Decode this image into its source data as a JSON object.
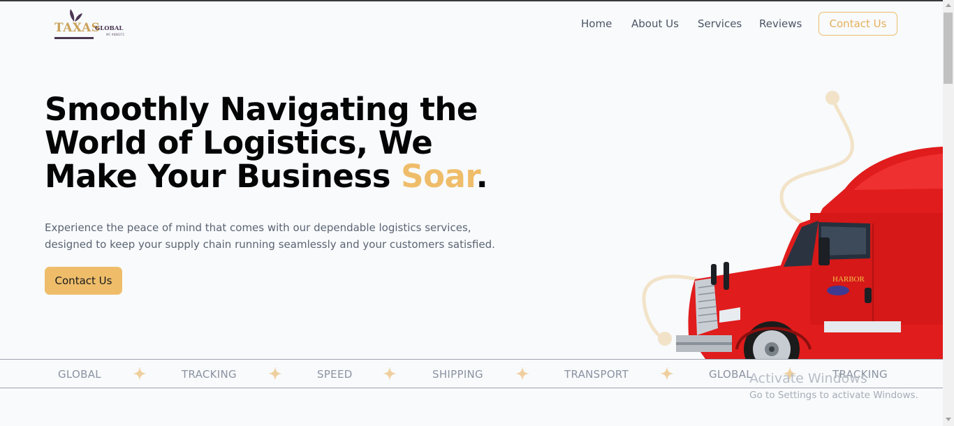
{
  "brand": {
    "logo_main": "TAXAS",
    "logo_side": "GLOBAL",
    "logo_sub": "MC #880271"
  },
  "nav": {
    "items": [
      {
        "label": "Home"
      },
      {
        "label": "About Us"
      },
      {
        "label": "Services"
      },
      {
        "label": "Reviews"
      }
    ],
    "cta_label": "Contact Us"
  },
  "hero": {
    "headline_line1": "Smoothly Navigating the",
    "headline_line2": "World of Logistics, We",
    "headline_line3_start": "Make Your Business ",
    "headline_accent": "Soar",
    "headline_end": ".",
    "subtext": "Experience the peace of mind that comes with our dependable logistics services, designed to keep your supply chain running seamlessly and your customers satisfied.",
    "cta_label": "Contact Us",
    "truck_text": "HARBOR"
  },
  "ticker": {
    "words": [
      "GLOBAL",
      "TRACKING",
      "SPEED",
      "SHIPPING",
      "TRANSPORT",
      "GLOBAL",
      "TRACKING"
    ]
  },
  "watermark": {
    "title": "Activate Windows",
    "subtitle": "Go to Settings to activate Windows."
  },
  "colors": {
    "accent": "#efbd6a",
    "truck_red": "#e01c1c",
    "text_dark": "#050505",
    "text_muted": "#5b6472"
  },
  "icons": {
    "ticker_separator": "four-point-star-icon",
    "logo_leaf": "leaf-icon"
  }
}
